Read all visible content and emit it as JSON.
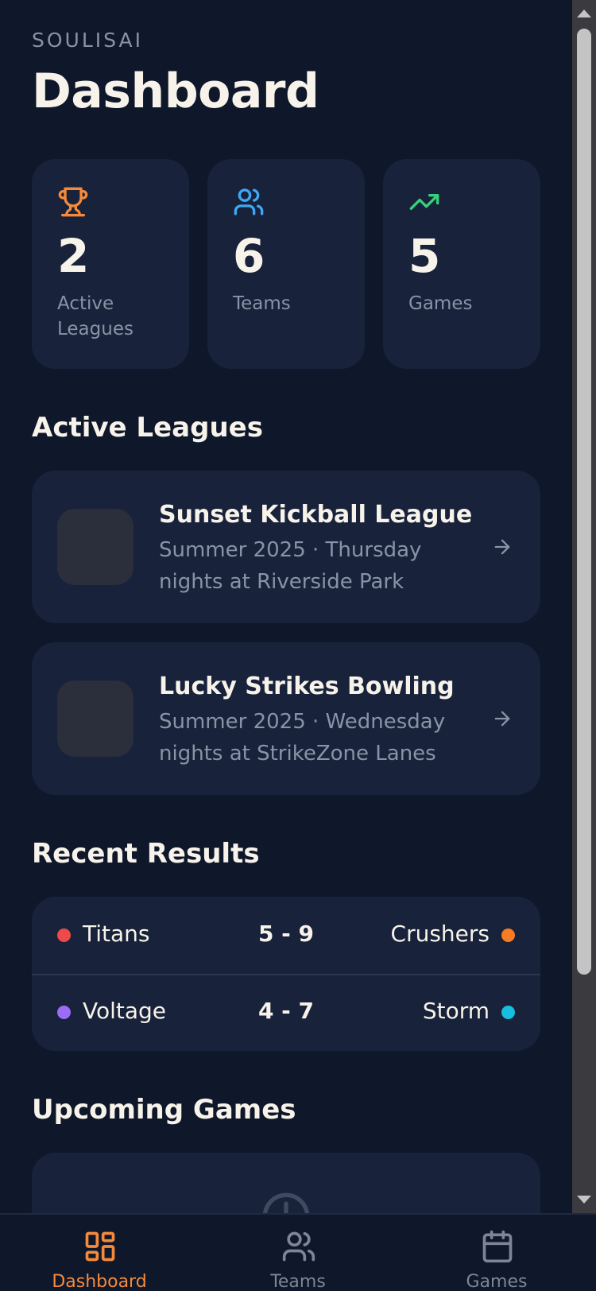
{
  "header": {
    "brand": "SOULISAI",
    "title": "Dashboard"
  },
  "stats": [
    {
      "icon": "trophy-icon",
      "value": "2",
      "label": "Active Leagues",
      "color": "#f58a3b"
    },
    {
      "icon": "users-icon",
      "value": "6",
      "label": "Teams",
      "color": "#3da9f5"
    },
    {
      "icon": "trending-up-icon",
      "value": "5",
      "label": "Games",
      "color": "#34d27a"
    }
  ],
  "active_leagues": {
    "title": "Active Leagues",
    "items": [
      {
        "name": "Sunset Kickball League",
        "description": "Summer 2025 · Thursday nights at Riverside Park"
      },
      {
        "name": "Lucky Strikes Bowling",
        "description": "Summer 2025 · Wednesday nights at StrikeZone Lanes"
      }
    ]
  },
  "recent_results": {
    "title": "Recent Results",
    "items": [
      {
        "home": "Titans",
        "home_color": "#ef4a4a",
        "score": "5 - 9",
        "away": "Crushers",
        "away_color": "#f97b22"
      },
      {
        "home": "Voltage",
        "home_color": "#9b6cf5",
        "score": "4 - 7",
        "away": "Storm",
        "away_color": "#16bfe0"
      }
    ]
  },
  "upcoming_games": {
    "title": "Upcoming Games"
  },
  "nav": {
    "items": [
      {
        "label": "Dashboard",
        "icon": "grid-icon",
        "active": true
      },
      {
        "label": "Teams",
        "icon": "users-icon",
        "active": false
      },
      {
        "label": "Games",
        "icon": "calendar-icon",
        "active": false
      }
    ]
  },
  "colors": {
    "background": "#0f172a",
    "card": "#18223a",
    "accent": "#f58a3b",
    "muted": "#8a93a6"
  }
}
